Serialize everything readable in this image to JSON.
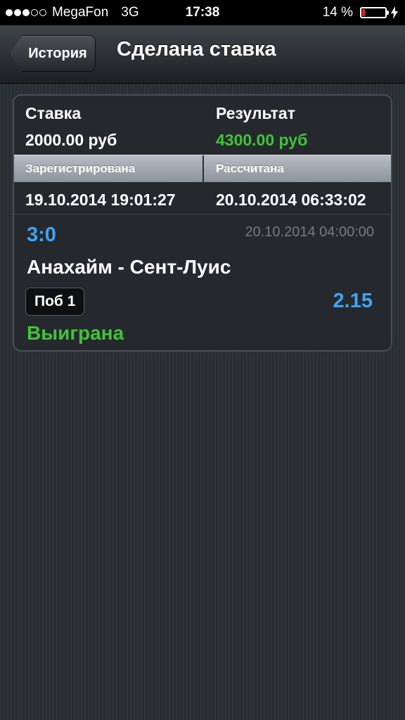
{
  "status_bar": {
    "signal_dots": [
      true,
      true,
      true,
      false,
      false
    ],
    "carrier": "MegaFon",
    "network": "3G",
    "time": "17:38",
    "battery_percent": "14 %",
    "battery_level": 0.14,
    "battery_color": "#e0262b",
    "charging_icon": "bolt-icon"
  },
  "nav": {
    "back_label": "История",
    "title": "Сделана ставка"
  },
  "bet": {
    "stake_label": "Ставка",
    "stake_value": "2000.00 руб",
    "result_label": "Результат",
    "result_value": "4300.00 руб",
    "registered_header": "Зарегистрирована",
    "settled_header": "Рассчитана",
    "registered_at": "19.10.2014 19:01:27",
    "settled_at": "20.10.2014 06:33:02",
    "score": "3:0",
    "event_date": "20.10.2014 04:00:00",
    "teams": "Анахайм - Сент-Луис",
    "selection": "Поб 1",
    "odds": "2.15",
    "outcome": "Выиграна"
  },
  "colors": {
    "accent_blue": "#3fa4f2",
    "win_green": "#43c23a"
  }
}
